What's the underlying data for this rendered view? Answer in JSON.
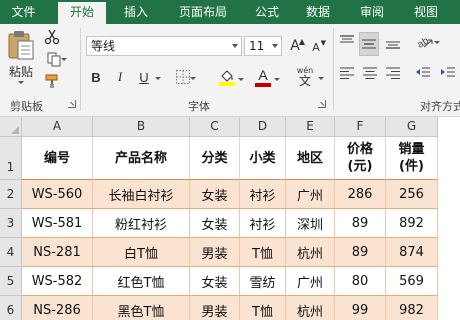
{
  "menu": {
    "tabs": [
      "文件",
      "开始",
      "插入",
      "页面布局",
      "公式",
      "数据",
      "审阅",
      "视图"
    ],
    "active": "开始"
  },
  "ribbon": {
    "clipboard": {
      "paste_label": "粘贴",
      "group_label": "剪贴板"
    },
    "font": {
      "font_name": "等线",
      "font_size": "11",
      "grow_label": "A",
      "shrink_label": "A",
      "bold": "B",
      "italic": "I",
      "underline": "U",
      "phonetic_label": "wén",
      "group_label": "字体"
    },
    "alignment": {
      "group_label": "对齐方式"
    }
  },
  "sheet": {
    "columns": [
      "A",
      "B",
      "C",
      "D",
      "E",
      "F",
      "G"
    ],
    "rows": [
      "1",
      "2",
      "3",
      "4",
      "5",
      "6"
    ],
    "header": [
      "编号",
      "产品名称",
      "分类",
      "小类",
      "地区",
      "价格\n(元)",
      "销量\n(件)"
    ],
    "data": [
      [
        "WS-560",
        "长袖白衬衫",
        "女装",
        "衬衫",
        "广州",
        "286",
        "256"
      ],
      [
        "WS-581",
        "粉红衬衫",
        "女装",
        "衬衫",
        "深圳",
        "89",
        "892"
      ],
      [
        "NS-281",
        "白T恤",
        "男装",
        "T恤",
        "杭州",
        "89",
        "874"
      ],
      [
        "WS-582",
        "红色T恤",
        "女装",
        "雪纺",
        "广州",
        "80",
        "569"
      ],
      [
        "NS-286",
        "黑色T恤",
        "男装",
        "T恤",
        "杭州",
        "99",
        "982"
      ]
    ]
  },
  "colors": {
    "brand": "#217346",
    "row_band": "#fbe3d2",
    "border_accent": "#e08a4c",
    "font_color": "#c00000",
    "fill_color": "#ffff00"
  }
}
